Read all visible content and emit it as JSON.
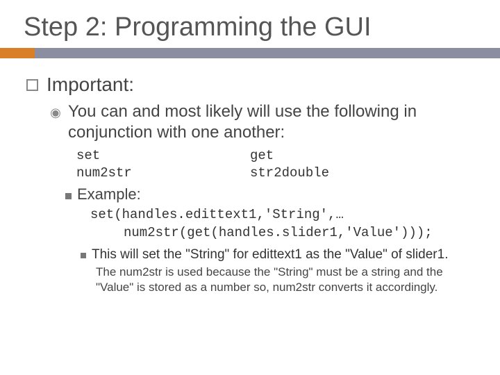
{
  "title": "Step 2: Programming the GUI",
  "l1": "Important:",
  "l2": "You can and most likely will use the following in conjunction with one another:",
  "functions": {
    "col1": [
      "set",
      "num2str"
    ],
    "col2": [
      "get",
      "str2double"
    ]
  },
  "example_label": "Example:",
  "code": {
    "line1": "set(handles.edittext1,'String',…",
    "line2": "num2str(get(handles.slider1,'Value')));"
  },
  "explain1": "This will set the \"String\" for edittext1 as the \"Value\" of slider1.",
  "explain2": "The num2str is used because the \"String\" must be a string and the \"Value\" is stored as a number so, num2str converts it accordingly."
}
